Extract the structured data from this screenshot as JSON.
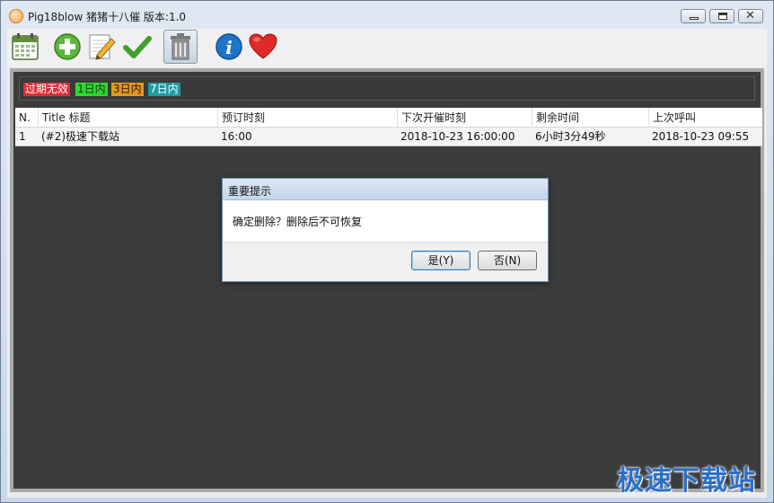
{
  "window": {
    "title": "Pig18blow 猪猪十八催 版本:1.0",
    "controls": [
      "minimize",
      "maximize",
      "close"
    ]
  },
  "toolbar": {
    "buttons": [
      {
        "icon": "calendar-icon"
      },
      {
        "icon": "add-icon"
      },
      {
        "icon": "edit-icon"
      },
      {
        "icon": "checkmark-icon"
      },
      {
        "icon": "trash-icon",
        "selected": true
      },
      {
        "icon": "info-icon"
      },
      {
        "icon": "heart-icon"
      }
    ]
  },
  "legend": {
    "expired": "过期无效",
    "day1": "1日内",
    "day3": "3日内",
    "day7": "7日内"
  },
  "colors": {
    "expired": "#d8303b",
    "day1": "#30d82f",
    "day3": "#e09a1c",
    "day7": "#1e9aa0",
    "content_bg": "#3c3c3c"
  },
  "table": {
    "headers": [
      "N.",
      "Title 标题",
      "预订时刻",
      "下次开催时刻",
      "剩余时间",
      "上次呼叫"
    ],
    "rows": [
      [
        "1",
        "(#2)极速下载站",
        "16:00",
        "2018-10-23 16:00:00",
        "6小时3分49秒",
        "2018-10-23 09:55"
      ]
    ]
  },
  "dialog": {
    "title": "重要提示",
    "message": "确定删除？删除后不可恢复",
    "yes": "是(Y)",
    "no": "否(N)"
  },
  "watermark": "极速下载站"
}
